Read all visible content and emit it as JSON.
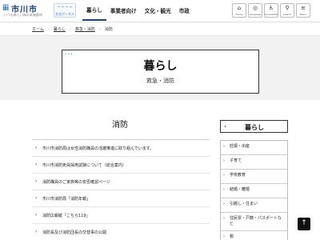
{
  "header": {
    "logo_mark": "iii",
    "logo_name": "市川市",
    "logo_tagline": "いつも新しい街の未来都市",
    "portal_label": "文化ポータル",
    "nav": [
      "暮らし",
      "事業者向け",
      "文化・観光",
      "市政"
    ],
    "utilities": [
      {
        "glyph": "⌂",
        "label": "Home",
        "icon": "home-icon"
      },
      {
        "glyph": "◎",
        "label": "Language",
        "icon": "globe-icon"
      },
      {
        "glyph": "♿",
        "label": "Accessibility",
        "icon": "accessibility-icon"
      },
      {
        "glyph": "⚲",
        "label": "Search",
        "icon": "search-icon"
      },
      {
        "glyph": "≡",
        "label": "Menu",
        "icon": "menu-icon"
      }
    ]
  },
  "breadcrumb": {
    "items": [
      "ホーム",
      "暮らし",
      "救急・消防",
      "消防"
    ]
  },
  "hero": {
    "dots": "• • •",
    "title": "暮らし",
    "subtitle": "救急・消防"
  },
  "main": {
    "title": "消防",
    "items": [
      "市川市消防局は女性消防職員の活躍推進に取り組んでいます。",
      "市川市消防吏員採用試験について（総合案内）",
      "消防職員のご家族等の安否確認ページ",
      "市川市消防局「消防年報」",
      "消防広報紙「こちら119」",
      "消防長及び消防団長の交替事の公開"
    ]
  },
  "sidebar": {
    "title": "暮らし",
    "items": [
      "妊娠・出産",
      "子育て",
      "学校教育",
      "結婚・離婚",
      "引越し・住まい",
      "住民票・戸籍・パスポートなど",
      "税"
    ]
  },
  "pagetop": {
    "glyph": "↑"
  }
}
